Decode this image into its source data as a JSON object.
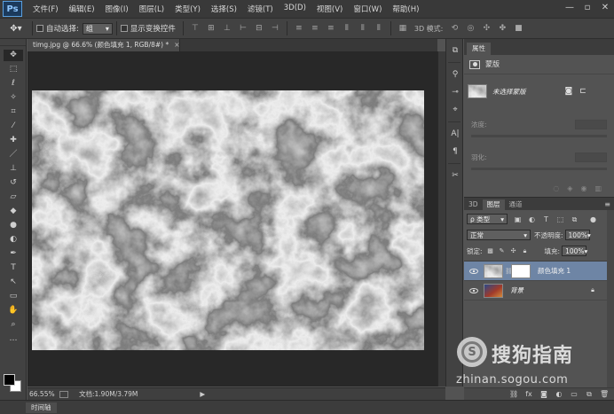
{
  "app": {
    "logo_text": "Ps",
    "menu": [
      "文件(F)",
      "编辑(E)",
      "图像(I)",
      "图层(L)",
      "类型(Y)",
      "选择(S)",
      "滤镜(T)",
      "3D(D)",
      "视图(V)",
      "窗口(W)",
      "帮助(H)"
    ],
    "window_controls": [
      "—",
      "▫",
      "✕"
    ]
  },
  "options_bar": {
    "tool_icon": "move-tool-icon",
    "auto_select_label": "自动选择:",
    "auto_select_value": "组",
    "show_transform_label": "显示变换控件",
    "mode_3d_label": "3D 模式:"
  },
  "document": {
    "tab_title": "timg.jpg @ 66.6% (颜色填充 1, RGB/8#) *",
    "tab_close": "×",
    "zoom": "66.55%",
    "doc_info": "文档:1.90M/3.79M",
    "status_arrow": "▶"
  },
  "timeline": {
    "label": "时间轴"
  },
  "properties": {
    "tab_label": "属性",
    "title": "蒙版",
    "layer_name": "未选择蒙版",
    "density_label": "浓度:",
    "feather_label": "羽化:"
  },
  "layers": {
    "tabs": [
      "3D",
      "图层",
      "通道"
    ],
    "active_tab": 1,
    "menu_glyph": "≡",
    "filter_type": "ρ 类型",
    "blend_mode": "正常",
    "opacity_label": "不透明度:",
    "opacity_value": "100%",
    "lock_label": "锁定:",
    "fill_label": "填充:",
    "fill_value": "100%",
    "items": [
      {
        "name": "颜色填充 1",
        "selected": true,
        "has_mask": true,
        "locked": false
      },
      {
        "name": "背景",
        "selected": false,
        "has_mask": false,
        "locked": true
      }
    ]
  },
  "watermark": {
    "logo_letter": "S",
    "title": "搜狗指南",
    "url": "zhinan.sogou.com"
  },
  "colors": {
    "accent_selected_layer": "#6e85a5",
    "foreground": "#000000",
    "background": "#ffffff"
  }
}
